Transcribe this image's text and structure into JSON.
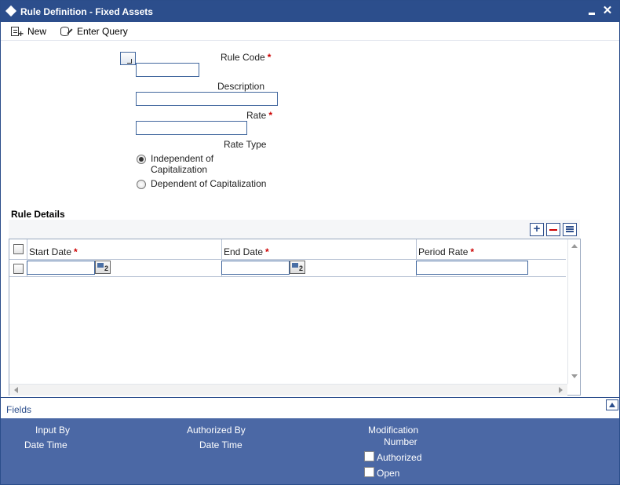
{
  "window": {
    "title": "Rule Definition - Fixed Assets"
  },
  "toolbar": {
    "new_label": "New",
    "enter_query_label": "Enter Query"
  },
  "form": {
    "rule_code": {
      "label": "Rule Code",
      "value": ""
    },
    "description": {
      "label": "Description",
      "value": ""
    },
    "rate": {
      "label": "Rate",
      "value": ""
    },
    "rate_type": {
      "label": "Rate Type",
      "options": [
        {
          "label_line1": "Independent of",
          "label_line2": "Capitalization",
          "selected": true
        },
        {
          "label_line1": "Dependent of Capitalization",
          "selected": false
        }
      ]
    },
    "required_mark": "*"
  },
  "rule_details": {
    "title": "Rule Details",
    "columns": [
      {
        "label": "Start Date",
        "required": "*"
      },
      {
        "label": "End Date",
        "required": "*"
      },
      {
        "label": "Period Rate",
        "required": "*"
      }
    ],
    "rows": [
      {
        "start_date": "",
        "end_date": "",
        "period_rate": ""
      }
    ]
  },
  "fields_bar": {
    "label": "Fields"
  },
  "audit": {
    "input_by": "Input By",
    "input_date_time": "Date Time",
    "authorized_by": "Authorized By",
    "authorized_date_time": "Date Time",
    "modification": "Modification",
    "number": "Number",
    "authorized": "Authorized",
    "open": "Open"
  },
  "colors": {
    "title_bar": "#2c4e8c",
    "audit_panel": "#4b68a5",
    "required": "#cc0000"
  },
  "icons": [
    "diamond-icon",
    "minimize-icon",
    "close-icon",
    "new-icon",
    "enter-query-icon",
    "lov-icon",
    "add-row-icon",
    "delete-row-icon",
    "single-view-icon",
    "calendar-icon",
    "collapse-icon"
  ]
}
